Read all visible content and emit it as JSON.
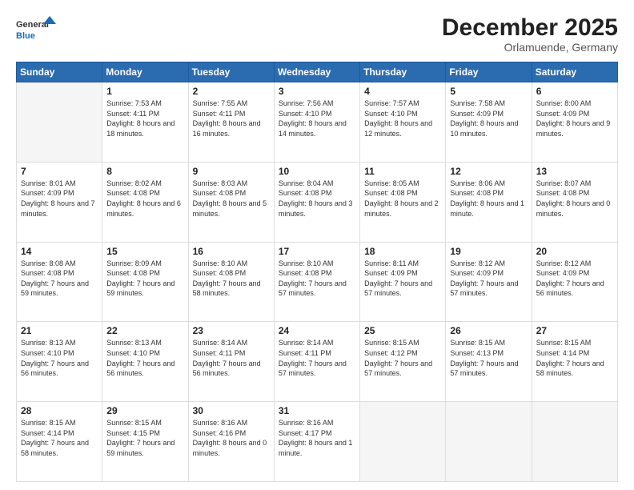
{
  "header": {
    "logo_line1": "General",
    "logo_line2": "Blue",
    "title": "December 2025",
    "subtitle": "Orlamuende, Germany"
  },
  "weekdays": [
    "Sunday",
    "Monday",
    "Tuesday",
    "Wednesday",
    "Thursday",
    "Friday",
    "Saturday"
  ],
  "weeks": [
    [
      {
        "day": "",
        "empty": true
      },
      {
        "day": "1",
        "sunrise": "7:53 AM",
        "sunset": "4:11 PM",
        "daylight": "8 hours and 18 minutes."
      },
      {
        "day": "2",
        "sunrise": "7:55 AM",
        "sunset": "4:11 PM",
        "daylight": "8 hours and 16 minutes."
      },
      {
        "day": "3",
        "sunrise": "7:56 AM",
        "sunset": "4:10 PM",
        "daylight": "8 hours and 14 minutes."
      },
      {
        "day": "4",
        "sunrise": "7:57 AM",
        "sunset": "4:10 PM",
        "daylight": "8 hours and 12 minutes."
      },
      {
        "day": "5",
        "sunrise": "7:58 AM",
        "sunset": "4:09 PM",
        "daylight": "8 hours and 10 minutes."
      },
      {
        "day": "6",
        "sunrise": "8:00 AM",
        "sunset": "4:09 PM",
        "daylight": "8 hours and 9 minutes."
      }
    ],
    [
      {
        "day": "7",
        "sunrise": "8:01 AM",
        "sunset": "4:09 PM",
        "daylight": "8 hours and 7 minutes."
      },
      {
        "day": "8",
        "sunrise": "8:02 AM",
        "sunset": "4:08 PM",
        "daylight": "8 hours and 6 minutes."
      },
      {
        "day": "9",
        "sunrise": "8:03 AM",
        "sunset": "4:08 PM",
        "daylight": "8 hours and 5 minutes."
      },
      {
        "day": "10",
        "sunrise": "8:04 AM",
        "sunset": "4:08 PM",
        "daylight": "8 hours and 3 minutes."
      },
      {
        "day": "11",
        "sunrise": "8:05 AM",
        "sunset": "4:08 PM",
        "daylight": "8 hours and 2 minutes."
      },
      {
        "day": "12",
        "sunrise": "8:06 AM",
        "sunset": "4:08 PM",
        "daylight": "8 hours and 1 minute."
      },
      {
        "day": "13",
        "sunrise": "8:07 AM",
        "sunset": "4:08 PM",
        "daylight": "8 hours and 0 minutes."
      }
    ],
    [
      {
        "day": "14",
        "sunrise": "8:08 AM",
        "sunset": "4:08 PM",
        "daylight": "7 hours and 59 minutes."
      },
      {
        "day": "15",
        "sunrise": "8:09 AM",
        "sunset": "4:08 PM",
        "daylight": "7 hours and 59 minutes."
      },
      {
        "day": "16",
        "sunrise": "8:10 AM",
        "sunset": "4:08 PM",
        "daylight": "7 hours and 58 minutes."
      },
      {
        "day": "17",
        "sunrise": "8:10 AM",
        "sunset": "4:08 PM",
        "daylight": "7 hours and 57 minutes."
      },
      {
        "day": "18",
        "sunrise": "8:11 AM",
        "sunset": "4:09 PM",
        "daylight": "7 hours and 57 minutes."
      },
      {
        "day": "19",
        "sunrise": "8:12 AM",
        "sunset": "4:09 PM",
        "daylight": "7 hours and 57 minutes."
      },
      {
        "day": "20",
        "sunrise": "8:12 AM",
        "sunset": "4:09 PM",
        "daylight": "7 hours and 56 minutes."
      }
    ],
    [
      {
        "day": "21",
        "sunrise": "8:13 AM",
        "sunset": "4:10 PM",
        "daylight": "7 hours and 56 minutes."
      },
      {
        "day": "22",
        "sunrise": "8:13 AM",
        "sunset": "4:10 PM",
        "daylight": "7 hours and 56 minutes."
      },
      {
        "day": "23",
        "sunrise": "8:14 AM",
        "sunset": "4:11 PM",
        "daylight": "7 hours and 56 minutes."
      },
      {
        "day": "24",
        "sunrise": "8:14 AM",
        "sunset": "4:11 PM",
        "daylight": "7 hours and 57 minutes."
      },
      {
        "day": "25",
        "sunrise": "8:15 AM",
        "sunset": "4:12 PM",
        "daylight": "7 hours and 57 minutes."
      },
      {
        "day": "26",
        "sunrise": "8:15 AM",
        "sunset": "4:13 PM",
        "daylight": "7 hours and 57 minutes."
      },
      {
        "day": "27",
        "sunrise": "8:15 AM",
        "sunset": "4:14 PM",
        "daylight": "7 hours and 58 minutes."
      }
    ],
    [
      {
        "day": "28",
        "sunrise": "8:15 AM",
        "sunset": "4:14 PM",
        "daylight": "7 hours and 58 minutes."
      },
      {
        "day": "29",
        "sunrise": "8:15 AM",
        "sunset": "4:15 PM",
        "daylight": "7 hours and 59 minutes."
      },
      {
        "day": "30",
        "sunrise": "8:16 AM",
        "sunset": "4:16 PM",
        "daylight": "8 hours and 0 minutes."
      },
      {
        "day": "31",
        "sunrise": "8:16 AM",
        "sunset": "4:17 PM",
        "daylight": "8 hours and 1 minute."
      },
      {
        "day": "",
        "empty": true
      },
      {
        "day": "",
        "empty": true
      },
      {
        "day": "",
        "empty": true
      }
    ]
  ]
}
